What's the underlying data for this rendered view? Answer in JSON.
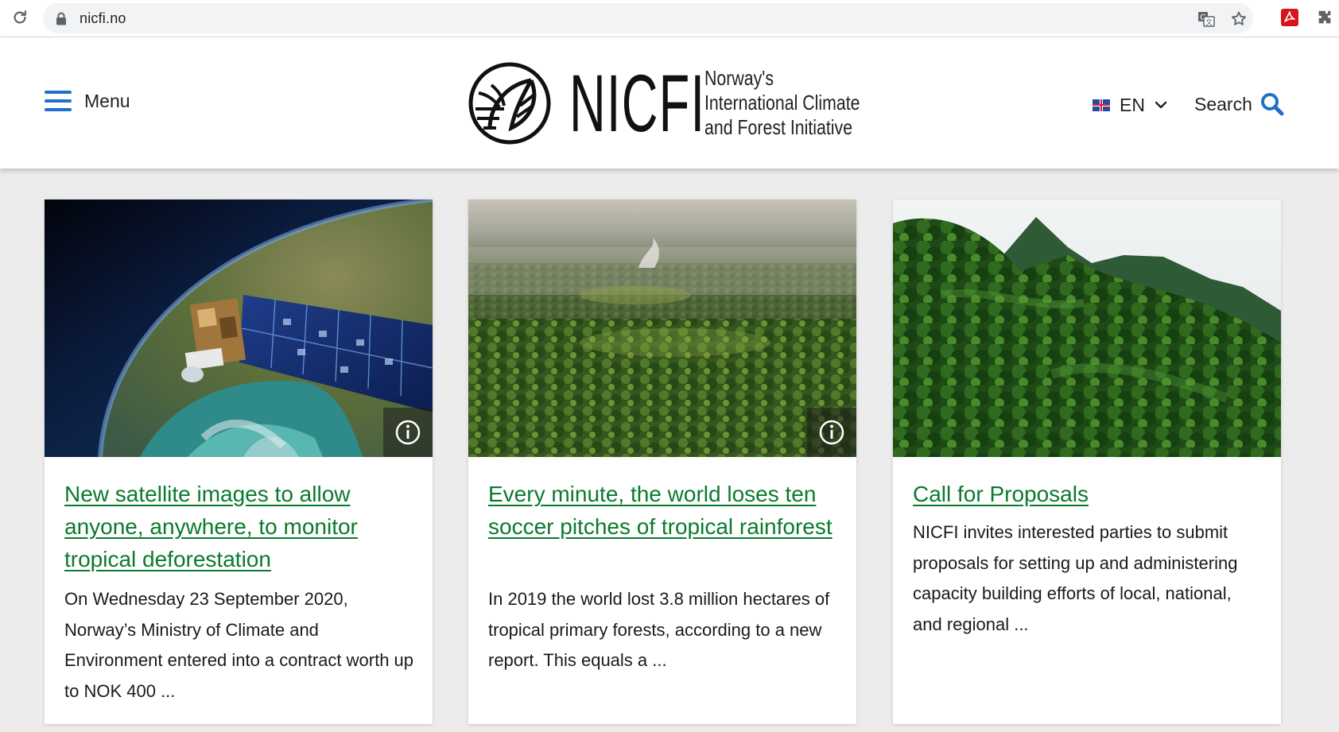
{
  "browser": {
    "url": "nicfi.no"
  },
  "header": {
    "menu_label": "Menu",
    "logo_wordmark": "NICFI",
    "logo_tagline_1": "Norway's",
    "logo_tagline_2": "International Climate",
    "logo_tagline_3": "and Forest Initiative",
    "language_label": "EN",
    "search_label": "Search"
  },
  "cards": [
    {
      "title": "New satellite images to allow anyone, anywhere, to monitor tropical deforestation",
      "body": "On Wednesday 23 September 2020, Norway’s Ministry of Climate and Environment entered into a contract worth up to NOK 400 ...",
      "image": "satellite-over-earth",
      "has_info_icon": true
    },
    {
      "title": "Every minute, the world loses ten soccer pitches of tropical rainforest",
      "body": "In 2019 the world lost 3.8 million hectares of tropical primary forests, according to a new report. This equals a ...",
      "image": "aerial-rainforest",
      "has_info_icon": true
    },
    {
      "title": "Call for Proposals",
      "body": "NICFI invites interested parties to submit proposals for setting up and administering capacity building efforts of local, national, and regional ...",
      "image": "forested-mountains",
      "has_info_icon": false
    }
  ],
  "colors": {
    "link_green": "#0a7a2c",
    "accent_blue": "#1e70c9",
    "page_background": "#ececec"
  }
}
